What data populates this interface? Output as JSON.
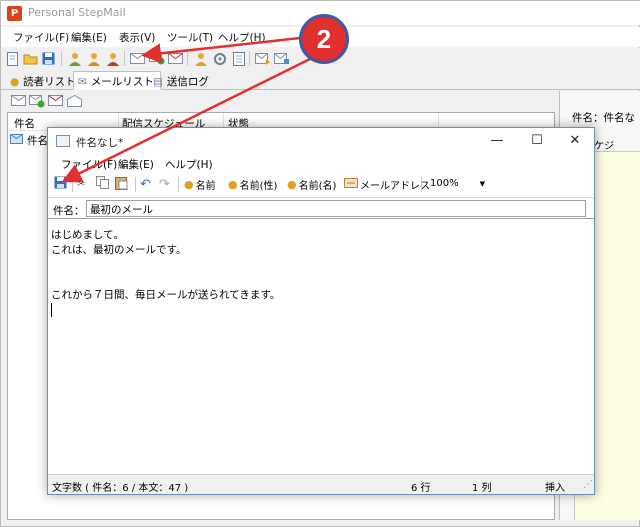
{
  "app": {
    "icon_glyph": "P",
    "title": "Personal StepMail",
    "menu": [
      "ファイル(F)",
      "編集(E)",
      "表示(V)",
      "ツール(T)",
      "ヘルプ(H)"
    ],
    "tabs": [
      {
        "label": "読者リスト",
        "icon": "reader-icon",
        "active": false
      },
      {
        "label": "メールリスト",
        "icon": "mail-list-icon",
        "active": true
      },
      {
        "label": "送信ログ",
        "icon": "log-icon",
        "active": false
      }
    ]
  },
  "list": {
    "columns": [
      "件名",
      "配信スケジュール",
      "状態"
    ],
    "rows": [
      {
        "subject": "件名"
      }
    ]
  },
  "right_panel": {
    "subject_label": "件名：件名な",
    "schedule_label": "配信スケジ"
  },
  "editor": {
    "title": "件名なし*",
    "controls": {
      "minimize": "—",
      "maximize": "☐",
      "close": "✕"
    },
    "menu": [
      "ファイル(F)",
      "編集(E)",
      "ヘルプ(H)"
    ],
    "insert_buttons": [
      "名前",
      "名前(性)",
      "名前(名)",
      "メールアドレス"
    ],
    "zoom": "100%",
    "subject_label": "件名：",
    "subject_value": "最初のメール",
    "body": "はじめまして。\nこれは、最初のメールです。\n\n\nこれから７日間、毎日メールが送られてきます。",
    "status": {
      "char_count": "文字数 ( 件名：6 / 本文：47 )",
      "line": "6 行",
      "col": "1 列",
      "mode": "挿入"
    }
  },
  "annotation": {
    "badge_number": "2",
    "color": "#e03030",
    "ring_color": "#3f58a8"
  }
}
